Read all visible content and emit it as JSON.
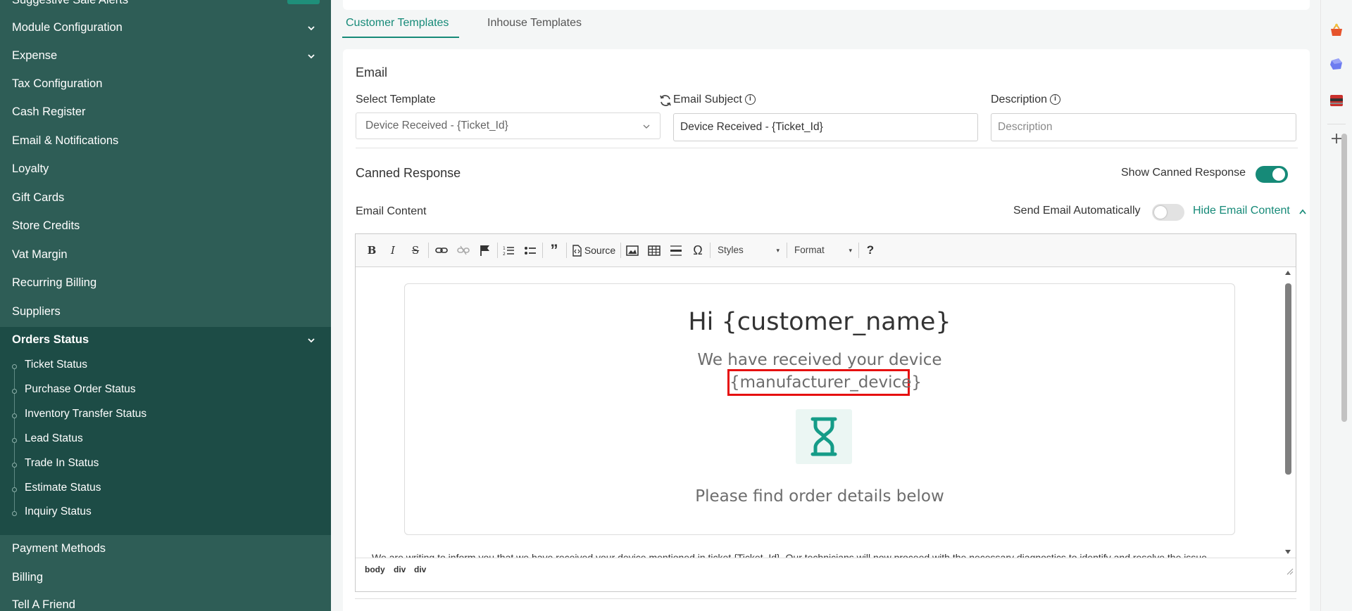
{
  "sidebar": {
    "partial_top": "Suggestive Sale Alerts",
    "items": [
      {
        "label": "Module Configuration"
      },
      {
        "label": "Expense"
      },
      {
        "label": "Tax Configuration"
      },
      {
        "label": "Cash Register"
      },
      {
        "label": "Email & Notifications"
      },
      {
        "label": "Loyalty"
      },
      {
        "label": "Gift Cards"
      },
      {
        "label": "Store Credits"
      },
      {
        "label": "Vat Margin"
      },
      {
        "label": "Recurring Billing"
      },
      {
        "label": "Suppliers"
      }
    ],
    "group": {
      "label": "Orders Status",
      "children": [
        {
          "label": "Ticket Status"
        },
        {
          "label": "Purchase Order Status"
        },
        {
          "label": "Inventory Transfer Status"
        },
        {
          "label": "Lead Status"
        },
        {
          "label": "Trade In Status"
        },
        {
          "label": "Estimate Status"
        },
        {
          "label": "Inquiry Status"
        }
      ]
    },
    "after": [
      {
        "label": "Payment Methods"
      },
      {
        "label": "Billing"
      },
      {
        "label": "Tell A Friend"
      }
    ]
  },
  "tabs": [
    {
      "label": "Customer Templates",
      "active": true
    },
    {
      "label": "Inhouse Templates",
      "active": false
    }
  ],
  "email_section": {
    "title": "Email",
    "select_template_label": "Select Template",
    "select_template_value": "Device Received - {Ticket_Id}",
    "email_subject_label": "Email Subject",
    "email_subject_value": "Device Received - {Ticket_Id}",
    "description_label": "Description",
    "description_placeholder": "Description"
  },
  "canned": {
    "title": "Canned Response",
    "show_label": "Show Canned Response",
    "show_on": true,
    "email_content_label": "Email Content",
    "send_auto_label": "Send Email Automatically",
    "send_auto_on": false,
    "hide_label": "Hide Email Content"
  },
  "editor": {
    "toolbar": {
      "source": "Source",
      "styles": "Styles",
      "format": "Format",
      "help": "?"
    },
    "content": {
      "greeting": "Hi {customer_name}",
      "received": "We have received your device",
      "manufacturer": "{manufacturer_device}",
      "find": "Please find order details below",
      "body": "We are writing to inform you that we have received your device mentioned in ticket {Ticket_Id}. Our technicians will now proceed with the necessary diagnostics to identify and resolve the issue."
    },
    "path": [
      "body",
      "div",
      "div"
    ]
  },
  "colors": {
    "accent": "#168a78",
    "sidebar": "#2e5d56",
    "sidebar_group": "#1d4c46",
    "highlight": "#e61010"
  }
}
